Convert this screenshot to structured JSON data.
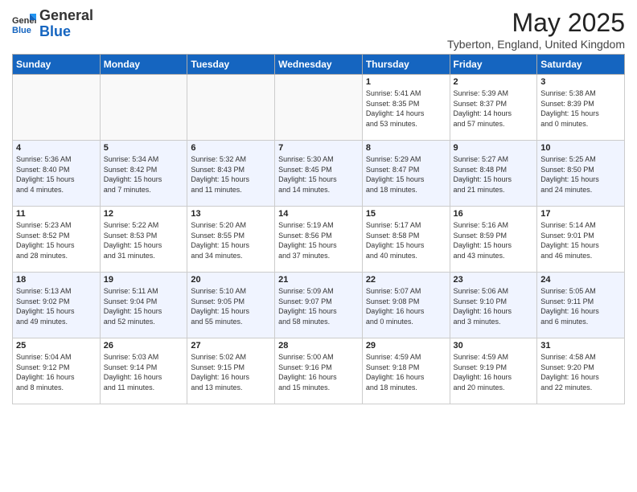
{
  "header": {
    "logo_general": "General",
    "logo_blue": "Blue",
    "month_title": "May 2025",
    "location": "Tyberton, England, United Kingdom"
  },
  "days_of_week": [
    "Sunday",
    "Monday",
    "Tuesday",
    "Wednesday",
    "Thursday",
    "Friday",
    "Saturday"
  ],
  "weeks": [
    [
      {
        "day": "",
        "info": ""
      },
      {
        "day": "",
        "info": ""
      },
      {
        "day": "",
        "info": ""
      },
      {
        "day": "",
        "info": ""
      },
      {
        "day": "1",
        "info": "Sunrise: 5:41 AM\nSunset: 8:35 PM\nDaylight: 14 hours\nand 53 minutes."
      },
      {
        "day": "2",
        "info": "Sunrise: 5:39 AM\nSunset: 8:37 PM\nDaylight: 14 hours\nand 57 minutes."
      },
      {
        "day": "3",
        "info": "Sunrise: 5:38 AM\nSunset: 8:39 PM\nDaylight: 15 hours\nand 0 minutes."
      }
    ],
    [
      {
        "day": "4",
        "info": "Sunrise: 5:36 AM\nSunset: 8:40 PM\nDaylight: 15 hours\nand 4 minutes."
      },
      {
        "day": "5",
        "info": "Sunrise: 5:34 AM\nSunset: 8:42 PM\nDaylight: 15 hours\nand 7 minutes."
      },
      {
        "day": "6",
        "info": "Sunrise: 5:32 AM\nSunset: 8:43 PM\nDaylight: 15 hours\nand 11 minutes."
      },
      {
        "day": "7",
        "info": "Sunrise: 5:30 AM\nSunset: 8:45 PM\nDaylight: 15 hours\nand 14 minutes."
      },
      {
        "day": "8",
        "info": "Sunrise: 5:29 AM\nSunset: 8:47 PM\nDaylight: 15 hours\nand 18 minutes."
      },
      {
        "day": "9",
        "info": "Sunrise: 5:27 AM\nSunset: 8:48 PM\nDaylight: 15 hours\nand 21 minutes."
      },
      {
        "day": "10",
        "info": "Sunrise: 5:25 AM\nSunset: 8:50 PM\nDaylight: 15 hours\nand 24 minutes."
      }
    ],
    [
      {
        "day": "11",
        "info": "Sunrise: 5:23 AM\nSunset: 8:52 PM\nDaylight: 15 hours\nand 28 minutes."
      },
      {
        "day": "12",
        "info": "Sunrise: 5:22 AM\nSunset: 8:53 PM\nDaylight: 15 hours\nand 31 minutes."
      },
      {
        "day": "13",
        "info": "Sunrise: 5:20 AM\nSunset: 8:55 PM\nDaylight: 15 hours\nand 34 minutes."
      },
      {
        "day": "14",
        "info": "Sunrise: 5:19 AM\nSunset: 8:56 PM\nDaylight: 15 hours\nand 37 minutes."
      },
      {
        "day": "15",
        "info": "Sunrise: 5:17 AM\nSunset: 8:58 PM\nDaylight: 15 hours\nand 40 minutes."
      },
      {
        "day": "16",
        "info": "Sunrise: 5:16 AM\nSunset: 8:59 PM\nDaylight: 15 hours\nand 43 minutes."
      },
      {
        "day": "17",
        "info": "Sunrise: 5:14 AM\nSunset: 9:01 PM\nDaylight: 15 hours\nand 46 minutes."
      }
    ],
    [
      {
        "day": "18",
        "info": "Sunrise: 5:13 AM\nSunset: 9:02 PM\nDaylight: 15 hours\nand 49 minutes."
      },
      {
        "day": "19",
        "info": "Sunrise: 5:11 AM\nSunset: 9:04 PM\nDaylight: 15 hours\nand 52 minutes."
      },
      {
        "day": "20",
        "info": "Sunrise: 5:10 AM\nSunset: 9:05 PM\nDaylight: 15 hours\nand 55 minutes."
      },
      {
        "day": "21",
        "info": "Sunrise: 5:09 AM\nSunset: 9:07 PM\nDaylight: 15 hours\nand 58 minutes."
      },
      {
        "day": "22",
        "info": "Sunrise: 5:07 AM\nSunset: 9:08 PM\nDaylight: 16 hours\nand 0 minutes."
      },
      {
        "day": "23",
        "info": "Sunrise: 5:06 AM\nSunset: 9:10 PM\nDaylight: 16 hours\nand 3 minutes."
      },
      {
        "day": "24",
        "info": "Sunrise: 5:05 AM\nSunset: 9:11 PM\nDaylight: 16 hours\nand 6 minutes."
      }
    ],
    [
      {
        "day": "25",
        "info": "Sunrise: 5:04 AM\nSunset: 9:12 PM\nDaylight: 16 hours\nand 8 minutes."
      },
      {
        "day": "26",
        "info": "Sunrise: 5:03 AM\nSunset: 9:14 PM\nDaylight: 16 hours\nand 11 minutes."
      },
      {
        "day": "27",
        "info": "Sunrise: 5:02 AM\nSunset: 9:15 PM\nDaylight: 16 hours\nand 13 minutes."
      },
      {
        "day": "28",
        "info": "Sunrise: 5:00 AM\nSunset: 9:16 PM\nDaylight: 16 hours\nand 15 minutes."
      },
      {
        "day": "29",
        "info": "Sunrise: 4:59 AM\nSunset: 9:18 PM\nDaylight: 16 hours\nand 18 minutes."
      },
      {
        "day": "30",
        "info": "Sunrise: 4:59 AM\nSunset: 9:19 PM\nDaylight: 16 hours\nand 20 minutes."
      },
      {
        "day": "31",
        "info": "Sunrise: 4:58 AM\nSunset: 9:20 PM\nDaylight: 16 hours\nand 22 minutes."
      }
    ]
  ]
}
